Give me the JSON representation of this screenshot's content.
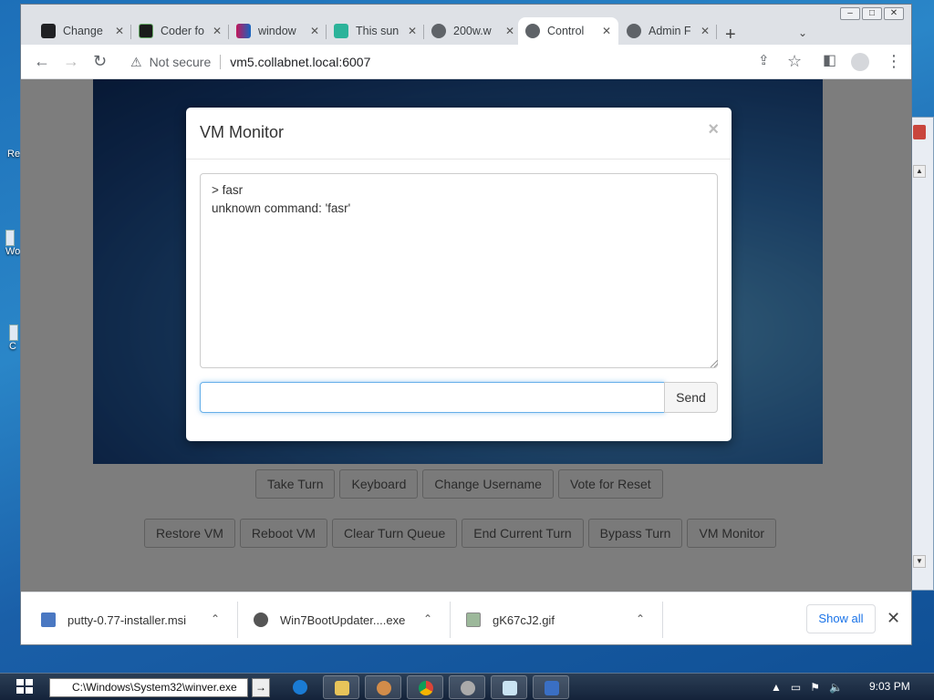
{
  "desktop": {
    "icons": [
      {
        "label": "Re"
      },
      {
        "label": "Wo"
      },
      {
        "label": "C"
      }
    ]
  },
  "browser": {
    "tabs": [
      {
        "label": "Change",
        "color": "#202124"
      },
      {
        "label": "Coder fo",
        "color": "#1b1b1b"
      },
      {
        "label": "window",
        "color": "#7b2d8e"
      },
      {
        "label": "This sun",
        "color": "#2cb39a"
      },
      {
        "label": "200w.w",
        "color": "#5f6368"
      },
      {
        "label": "Control",
        "color": "#5f6368"
      },
      {
        "label": "Admin F",
        "color": "#5f6368"
      }
    ],
    "active_tab_index": 5,
    "security_label": "Not secure",
    "url": "vm5.collabnet.local:6007"
  },
  "page": {
    "row1_buttons": [
      "Take Turn",
      "Keyboard",
      "Change Username",
      "Vote for Reset"
    ],
    "row2_buttons": [
      "Restore VM",
      "Reboot VM",
      "Clear Turn Queue",
      "End Current Turn",
      "Bypass Turn",
      "VM Monitor"
    ]
  },
  "modal": {
    "title": "VM Monitor",
    "close": "×",
    "console_text": "> fasr\nunknown command: 'fasr'",
    "input_value": "",
    "send_label": "Send"
  },
  "downloads": {
    "items": [
      {
        "name": "putty-0.77-installer.msi"
      },
      {
        "name": "Win7BootUpdater....exe"
      },
      {
        "name": "gK67cJ2.gif"
      }
    ],
    "show_all": "Show all"
  },
  "taskbar": {
    "run_value": "C:\\Windows\\System32\\winver.exe",
    "clock": "9:03 PM"
  }
}
